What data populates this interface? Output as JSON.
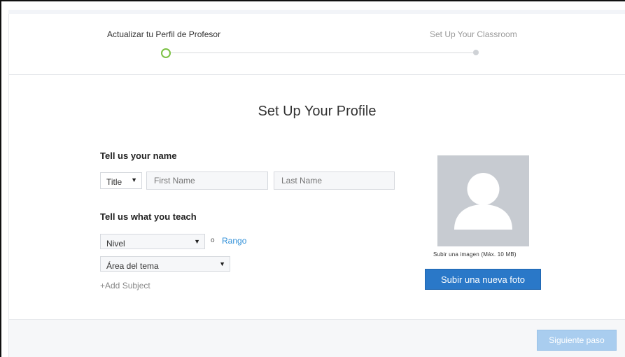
{
  "stepper": {
    "step1": "Actualizar tu Perfil de Profesor",
    "step2": "Set Up Your Classroom"
  },
  "page": {
    "title": "Set Up Your Profile"
  },
  "name_section": {
    "heading": "Tell us your name",
    "title_select": "Title",
    "first_name_placeholder": "First Name",
    "last_name_placeholder": "Last Name"
  },
  "teach_section": {
    "heading": "Tell us what you teach",
    "level_select": "Nivel",
    "or_text": "o",
    "range_link": "Rango",
    "subject_select": "Área del tema",
    "add_subject": "+Add Subject"
  },
  "photo": {
    "caption": "Subir una imagen (Máx. 10 MB)",
    "upload_button": "Subir una nueva foto"
  },
  "footer": {
    "next_button": "Siguiente paso"
  },
  "colors": {
    "accent_green": "#7bc143",
    "primary_blue": "#2a78c8",
    "disabled_blue": "#a9cdef",
    "link_blue": "#2f8fd8"
  },
  "icons": {
    "avatar": "user-silhouette-icon",
    "dropdown": "caret-down-icon"
  }
}
